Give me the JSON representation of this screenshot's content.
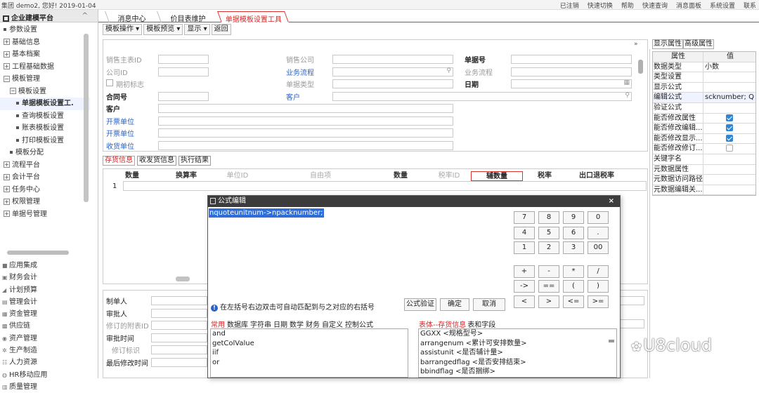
{
  "topbar": {
    "title": "集团 demo2, 您好! 2019-01-04",
    "actions": [
      "已注销",
      "快速切换",
      "帮助",
      "快速查询",
      "消息面板",
      "系统设置",
      "联系"
    ]
  },
  "sidebar": {
    "title": "企业建模平台",
    "tree": [
      {
        "label": "参数设置",
        "kind": "dot",
        "indent": 0
      },
      {
        "label": "基础信息",
        "kind": "plus",
        "indent": 0
      },
      {
        "label": "基本档案",
        "kind": "plus",
        "indent": 0
      },
      {
        "label": "工程基础数据",
        "kind": "plus",
        "indent": 0
      },
      {
        "label": "模板管理",
        "kind": "minus",
        "indent": 0
      },
      {
        "label": "模板设置",
        "kind": "minus",
        "indent": 1
      },
      {
        "label": "单据模板设置工.",
        "kind": "dot",
        "indent": 2,
        "selected": true
      },
      {
        "label": "查询模板设置",
        "kind": "dot",
        "indent": 2
      },
      {
        "label": "账表模板设置",
        "kind": "dot",
        "indent": 2
      },
      {
        "label": "打印模板设置",
        "kind": "dot",
        "indent": 2
      },
      {
        "label": "模板分配",
        "kind": "dot",
        "indent": 1
      },
      {
        "label": "流程平台",
        "kind": "plus",
        "indent": 0
      },
      {
        "label": "会计平台",
        "kind": "plus",
        "indent": 0
      },
      {
        "label": "任务中心",
        "kind": "plus",
        "indent": 0
      },
      {
        "label": "权限管理",
        "kind": "plus",
        "indent": 0
      },
      {
        "label": "单据号管理",
        "kind": "plus",
        "indent": 0
      }
    ],
    "groups": [
      {
        "label": "应用集成",
        "icon": "■"
      },
      {
        "label": "财务会计",
        "icon": "▣"
      },
      {
        "label": "计划预算",
        "icon": "◢"
      },
      {
        "label": "管理会计",
        "icon": "▤"
      },
      {
        "label": "资金管理",
        "icon": "▦"
      },
      {
        "label": "供应链",
        "icon": "▩"
      },
      {
        "label": "资产管理",
        "icon": "◉"
      },
      {
        "label": "生产制造",
        "icon": "✲"
      },
      {
        "label": "人力资源",
        "icon": "☷"
      },
      {
        "label": "HR移动应用",
        "icon": "◍"
      },
      {
        "label": "质量管理",
        "icon": "▥"
      }
    ]
  },
  "tabs": [
    {
      "label": "消息中心"
    },
    {
      "label": "价目表维护"
    },
    {
      "label": "单据模板设置工具",
      "active": true
    }
  ],
  "toolbar": {
    "template_ops": "模板操作 ▾",
    "template_preview": "模板预览 ▾",
    "display": "显示 ▾",
    "back": "返回"
  },
  "form": {
    "collapse": "»",
    "fields": [
      {
        "label": "销售主表ID",
        "style": "grey"
      },
      {
        "label": "公司ID",
        "style": "grey"
      },
      {
        "label": "期初标志",
        "style": "grey"
      },
      {
        "label": "合同号",
        "style": "bold"
      },
      {
        "label": "客户",
        "style": "bold"
      },
      {
        "label": "开票单位",
        "style": "blue"
      },
      {
        "label": "开票单位",
        "style": "blue"
      },
      {
        "label": "收货单位",
        "style": "blue"
      },
      {
        "label": "销售公司",
        "style": "grey"
      },
      {
        "label": "业务流程",
        "style": "blue"
      },
      {
        "label": "单据类型",
        "style": "grey"
      },
      {
        "label": "客户",
        "style": "blue"
      },
      {
        "label": "单据号",
        "style": "bold"
      },
      {
        "label": "业务流程",
        "style": "grey"
      },
      {
        "label": "日期",
        "style": "bold"
      }
    ]
  },
  "detail": {
    "tabs": [
      "存货信息",
      "收发货信息",
      "执行结果"
    ],
    "columns": [
      "数量",
      "换算率",
      "单位ID",
      "自由项",
      "数量",
      "税率ID",
      "辅数量",
      "税率",
      "出口退税率"
    ],
    "row_number": "1"
  },
  "bottom": {
    "fields": [
      "制单人",
      "审批人",
      "修订的附表ID",
      "审批时间",
      "修订标识",
      "最后修改时间"
    ]
  },
  "dialog": {
    "title": "公式编辑",
    "close": "×",
    "expression": "nquoteunitnum->npacknumber;",
    "keypad": [
      "7",
      "8",
      "9",
      "0",
      "4",
      "5",
      "6",
      ".",
      "1",
      "2",
      "3",
      "00",
      "+",
      "-",
      "*",
      "/",
      "->",
      "==",
      "(",
      ")",
      "<",
      ">",
      "<=",
      ">="
    ],
    "hint": "在左括号右边双击可自动匹配到与之对应的右括号",
    "btn_verify": "公式验证",
    "btn_ok": "确定",
    "btn_cancel": "取消",
    "func_tabs": [
      "常用",
      "数据库",
      "字符串",
      "日期",
      "数学",
      "财务",
      "自定义",
      "控制公式"
    ],
    "func_items": [
      "and",
      "getColValue",
      "iif",
      "or"
    ],
    "table_tabs": [
      "表体--存货信息",
      "表和字段"
    ],
    "table_items": [
      "GGXX <规格型号>",
      "arrangenum <累计可安排数量>",
      "assistunit <是否辅计量>",
      "barrangedflag <是否安排结束>",
      "bbindflag <是否捆绑>"
    ]
  },
  "props": {
    "tabs": [
      "显示属性",
      "高级属性"
    ],
    "header": {
      "key": "属性",
      "value": "值"
    },
    "rows": [
      {
        "key": "数据类型",
        "value": "小数"
      },
      {
        "key": "类型设置",
        "value": ""
      },
      {
        "key": "显示公式",
        "value": ""
      },
      {
        "key": "编辑公式",
        "value": "scknumber; Q",
        "selected": true
      },
      {
        "key": "验证公式",
        "value": ""
      },
      {
        "key": "能否修改属性",
        "check": true
      },
      {
        "key": "能否修改编辑...",
        "check": true
      },
      {
        "key": "能否修改显示...",
        "check": true
      },
      {
        "key": "能否修改修订...",
        "check": false
      },
      {
        "key": "关键字名",
        "value": ""
      },
      {
        "key": "元数据属性",
        "value": ""
      },
      {
        "key": "元数据访问路径",
        "value": ""
      },
      {
        "key": "元数据编辑关...",
        "value": ""
      }
    ]
  },
  "watermark": "U8cloud",
  "colors": {
    "accent_red": "#d22222",
    "link_blue": "#2b62c6",
    "selection_blue": "#2f6ed6"
  }
}
